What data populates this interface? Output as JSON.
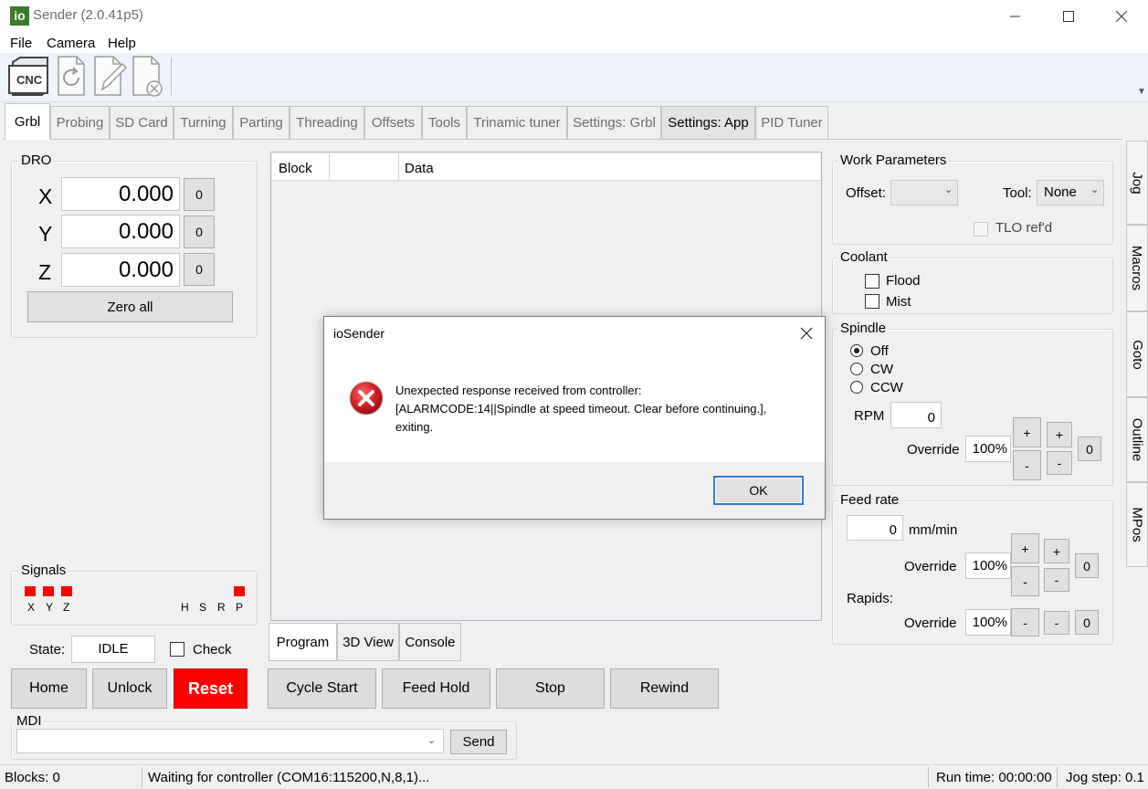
{
  "window": {
    "logo": "io",
    "title": "Sender (2.0.41p5)"
  },
  "menu": [
    "File",
    "Camera",
    "Help"
  ],
  "toolbar": {
    "cnc_label": "CNC",
    "buttons": [
      "cnc-icon",
      "reload-icon",
      "edit-file-icon",
      "close-file-icon"
    ]
  },
  "tabs": [
    "Grbl",
    "Probing",
    "SD Card",
    "Turning",
    "Parting",
    "Threading",
    "Offsets",
    "Tools",
    "Trinamic tuner",
    "Settings: Grbl",
    "Settings: App",
    "PID Tuner"
  ],
  "dro": {
    "title": "DRO",
    "axes": [
      {
        "label": "X",
        "value": "0.000",
        "button": "0"
      },
      {
        "label": "Y",
        "value": "0.000",
        "button": "0"
      },
      {
        "label": "Z",
        "value": "0.000",
        "button": "0"
      }
    ],
    "zero_all": "Zero all"
  },
  "signals": {
    "title": "Signals",
    "labels": [
      "X",
      "Y",
      "Z",
      "H",
      "S",
      "R",
      "P"
    ]
  },
  "state": {
    "label": "State:",
    "value": "IDLE",
    "check_label": "Check"
  },
  "machine_buttons": {
    "home": "Home",
    "unlock": "Unlock",
    "reset": "Reset"
  },
  "mdi": {
    "title": "MDI",
    "value": "",
    "send": "Send"
  },
  "grid": {
    "columns": [
      "Block",
      "",
      "Data"
    ]
  },
  "bottom_tabs": [
    "Program",
    "3D View",
    "Console"
  ],
  "program_buttons": [
    "Cycle Start",
    "Feed Hold",
    "Stop",
    "Rewind"
  ],
  "work_params": {
    "title": "Work Parameters",
    "offset_label": "Offset:",
    "offset_value": "",
    "tool_label": "Tool:",
    "tool_value": "None",
    "tlo_label": "TLO ref'd"
  },
  "coolant": {
    "title": "Coolant",
    "flood": "Flood",
    "mist": "Mist"
  },
  "spindle": {
    "title": "Spindle",
    "options": [
      "Off",
      "CW",
      "CCW"
    ],
    "selected": "Off",
    "rpm_label": "RPM",
    "rpm_value": "0",
    "override_label": "Override",
    "override_value": "100%",
    "plus": "+",
    "minus": "-",
    "reset": "0"
  },
  "feed": {
    "title": "Feed rate",
    "value": "0",
    "unit": "mm/min",
    "override_label": "Override",
    "override_value": "100%",
    "plus": "+",
    "minus": "-",
    "reset": "0",
    "rapids_label": "Rapids:",
    "rapids_override_label": "Override",
    "rapids_override_value": "100%",
    "rapids_reset": "0"
  },
  "side_tabs": [
    "Jog",
    "Macros",
    "Goto",
    "Outline",
    "MPos"
  ],
  "status": {
    "blocks": "Blocks: 0",
    "message": "Waiting for controller (COM16:115200,N,8,1)...",
    "run_time": "Run time: 00:00:00",
    "jog_step": "Jog step: 0.1"
  },
  "dialog": {
    "title": "ioSender",
    "line1": "Unexpected response received from controller:",
    "line2": "[ALARMCODE:14||Spindle at speed timeout. Clear before continuing.],",
    "line3": "exiting.",
    "ok": "OK"
  },
  "colors": {
    "reset_red": "#ff0000",
    "signal_red": "#ff0000",
    "logo_green": "#3c7a2c",
    "error_red": "#c8141e"
  }
}
